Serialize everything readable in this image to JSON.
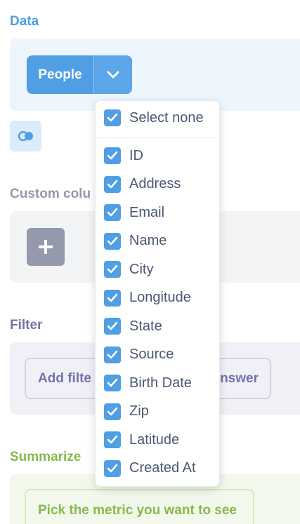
{
  "sections": {
    "data": "Data",
    "custom_columns": "Custom colu",
    "filter": "Filter",
    "summarize": "Summarize"
  },
  "data_step": {
    "table_name": "People",
    "chevron_icon": "chevron-down-icon",
    "join_icon": "join-icon"
  },
  "custom_column": {
    "add_icon": "plus-icon"
  },
  "filter_step": {
    "add_filter_label": "Add filte",
    "answer_label": "nswer"
  },
  "summarize_step": {
    "metric_label": "Pick the metric you want to see"
  },
  "column_picker": {
    "select_none": "Select none",
    "columns": [
      "ID",
      "Address",
      "Email",
      "Name",
      "City",
      "Longitude",
      "State",
      "Source",
      "Birth Date",
      "Zip",
      "Latitude",
      "Created At"
    ],
    "all_checked": true
  },
  "colors": {
    "data": "#509ee3",
    "custom": "#949aab",
    "filter": "#7172ad",
    "summarize": "#84bb4c"
  }
}
